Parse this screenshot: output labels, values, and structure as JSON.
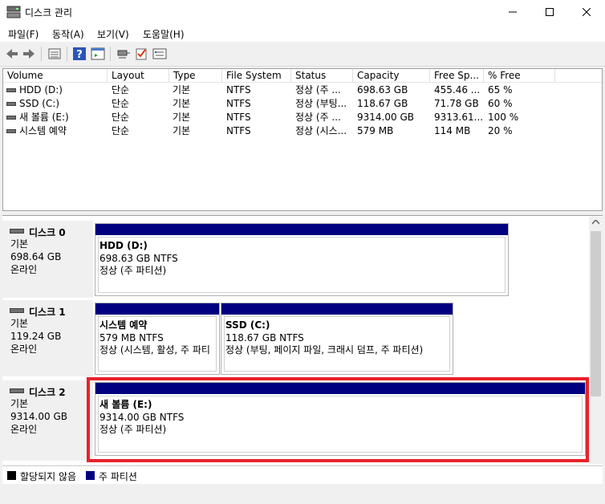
{
  "window": {
    "title": "디스크 관리"
  },
  "menu": [
    "파일(F)",
    "동작(A)",
    "보기(V)",
    "도움말(H)"
  ],
  "toolbar_icons": [
    "back-icon",
    "forward-icon",
    "list-view-icon",
    "help-icon",
    "console-icon",
    "connect-icon",
    "check-icon",
    "properties-icon"
  ],
  "volume_list": {
    "columns": [
      "Volume",
      "Layout",
      "Type",
      "File System",
      "Status",
      "Capacity",
      "Free Sp...",
      "% Free"
    ],
    "rows": [
      [
        "HDD (D:)",
        "단순",
        "기본",
        "NTFS",
        "정상 (주 ...",
        "698.63 GB",
        "455.46 ...",
        "65 %"
      ],
      [
        "SSD (C:)",
        "단순",
        "기본",
        "NTFS",
        "정상 (부팅...",
        "118.67 GB",
        "71.78 GB",
        "60 %"
      ],
      [
        "새 볼륨 (E:)",
        "단순",
        "기본",
        "NTFS",
        "정상 (주 ...",
        "9314.00 GB",
        "9313.61...",
        "100 %"
      ],
      [
        "시스템 예약",
        "단순",
        "기본",
        "NTFS",
        "정상 (시스...",
        "579 MB",
        "114 MB",
        "20 %"
      ]
    ]
  },
  "disks": [
    {
      "name": "디스크 0",
      "type": "기본",
      "size": "698.64 GB",
      "state": "온라인",
      "partitions": [
        {
          "title": "HDD  (D:)",
          "size": "698.63 GB NTFS",
          "status": "정상 (주 파티션)"
        }
      ]
    },
    {
      "name": "디스크 1",
      "type": "기본",
      "size": "119.24 GB",
      "state": "온라인",
      "partitions": [
        {
          "title": "시스템 예약",
          "size": "579 MB NTFS",
          "status": "정상 (시스템, 활성, 주 파티"
        },
        {
          "title": "SSD  (C:)",
          "size": "118.67 GB NTFS",
          "status": "정상 (부팅, 페이지 파일, 크래시 덤프, 주 파티션)"
        }
      ]
    },
    {
      "name": "디스크 2",
      "type": "기본",
      "size": "9314.00 GB",
      "state": "온라인",
      "partitions": [
        {
          "title": "새 볼륨  (E:)",
          "size": "9314.00 GB NTFS",
          "status": "정상 (주 파티션)"
        }
      ]
    }
  ],
  "legend": [
    {
      "label": "할당되지 않음",
      "color": "#000000"
    },
    {
      "label": "주 파티션",
      "color": "#000080"
    }
  ],
  "colors": {
    "partition_bar": "#000080",
    "highlight": "#e8222a"
  }
}
